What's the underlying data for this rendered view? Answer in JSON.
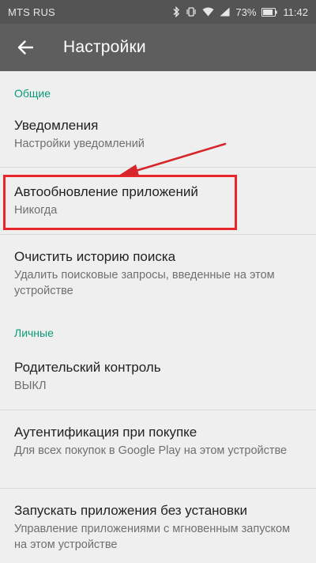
{
  "status_bar": {
    "carrier": "MTS RUS",
    "battery": "73%",
    "time": "11:42"
  },
  "toolbar": {
    "back_icon": "arrow-left-icon",
    "title": "Настройки"
  },
  "sections": {
    "general": {
      "header": "Общие",
      "items": [
        {
          "title": "Уведомления",
          "subtitle": "Настройки уведомлений"
        },
        {
          "title": "Автообновление приложений",
          "subtitle": "Никогда"
        },
        {
          "title": "Очистить историю поиска",
          "subtitle": "Удалить поисковые запросы, введенные на этом устройстве"
        }
      ]
    },
    "personal": {
      "header": "Личные",
      "items": [
        {
          "title": "Родительский контроль",
          "subtitle": "ВЫКЛ"
        },
        {
          "title": "Аутентификация при покупке",
          "subtitle": "Для всех покупок в Google Play на этом устройстве"
        },
        {
          "title": "Запускать приложения без установки",
          "subtitle": "Управление приложениями с мгновенным запуском на этом устройстве"
        }
      ]
    }
  },
  "colors": {
    "accent": "#0a9a7a",
    "toolbar": "#5e5e5e",
    "status_bar": "#545454",
    "highlight": "#e8262b"
  }
}
